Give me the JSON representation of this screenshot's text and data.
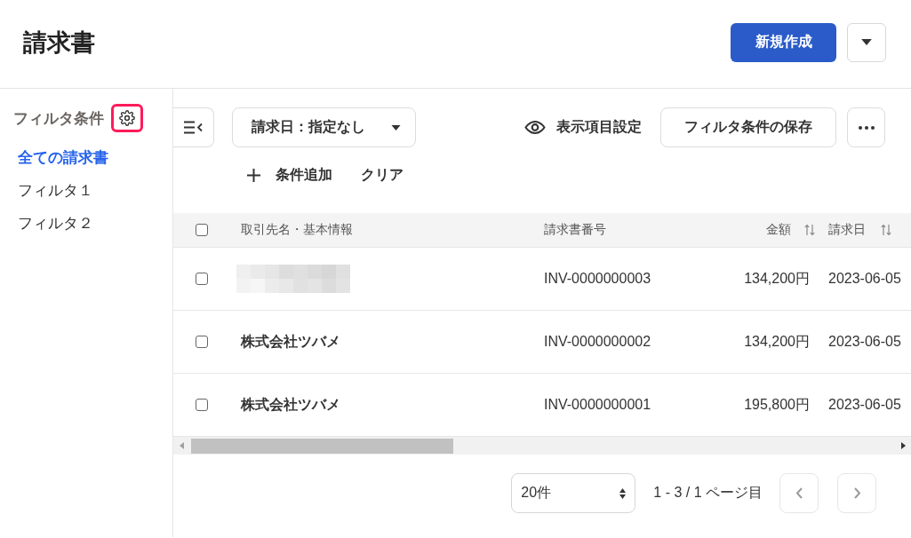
{
  "header": {
    "title": "請求書",
    "create_button": "新規作成"
  },
  "sidebar": {
    "heading": "フィルタ条件",
    "settings_highlighted": true,
    "items": [
      {
        "label": "全ての請求書",
        "selected": true
      },
      {
        "label": "フィルタ１",
        "selected": false
      },
      {
        "label": "フィルタ２",
        "selected": false
      }
    ]
  },
  "toolbar": {
    "date_filter": "請求日：指定なし",
    "column_settings": "表示項目設定",
    "save_filter": "フィルタ条件の保存",
    "add_condition": "条件追加",
    "clear": "クリア"
  },
  "table": {
    "all_checked": false,
    "columns": [
      {
        "label": "取引先名・基本情報",
        "sortable": false
      },
      {
        "label": "請求書番号",
        "sortable": false
      },
      {
        "label": "金額",
        "sortable": true
      },
      {
        "label": "請求日",
        "sortable": true
      }
    ],
    "rows": [
      {
        "checked": false,
        "customer_hidden": true,
        "number": "INV-0000000003",
        "amount": "134,200円",
        "date": "2023-06-05"
      },
      {
        "checked": false,
        "customer_hidden": false,
        "customer": "株式会社ツバメ",
        "number": "INV-0000000002",
        "amount": "134,200円",
        "date": "2023-06-05"
      },
      {
        "checked": false,
        "customer_hidden": false,
        "customer": "株式会社ツバメ",
        "number": "INV-0000000001",
        "amount": "195,800円",
        "date": "2023-06-05"
      }
    ]
  },
  "pagination": {
    "page_size": "20件",
    "range": "1 - 3 / 1 ページ目",
    "prev_disabled": true,
    "next_disabled": true
  }
}
